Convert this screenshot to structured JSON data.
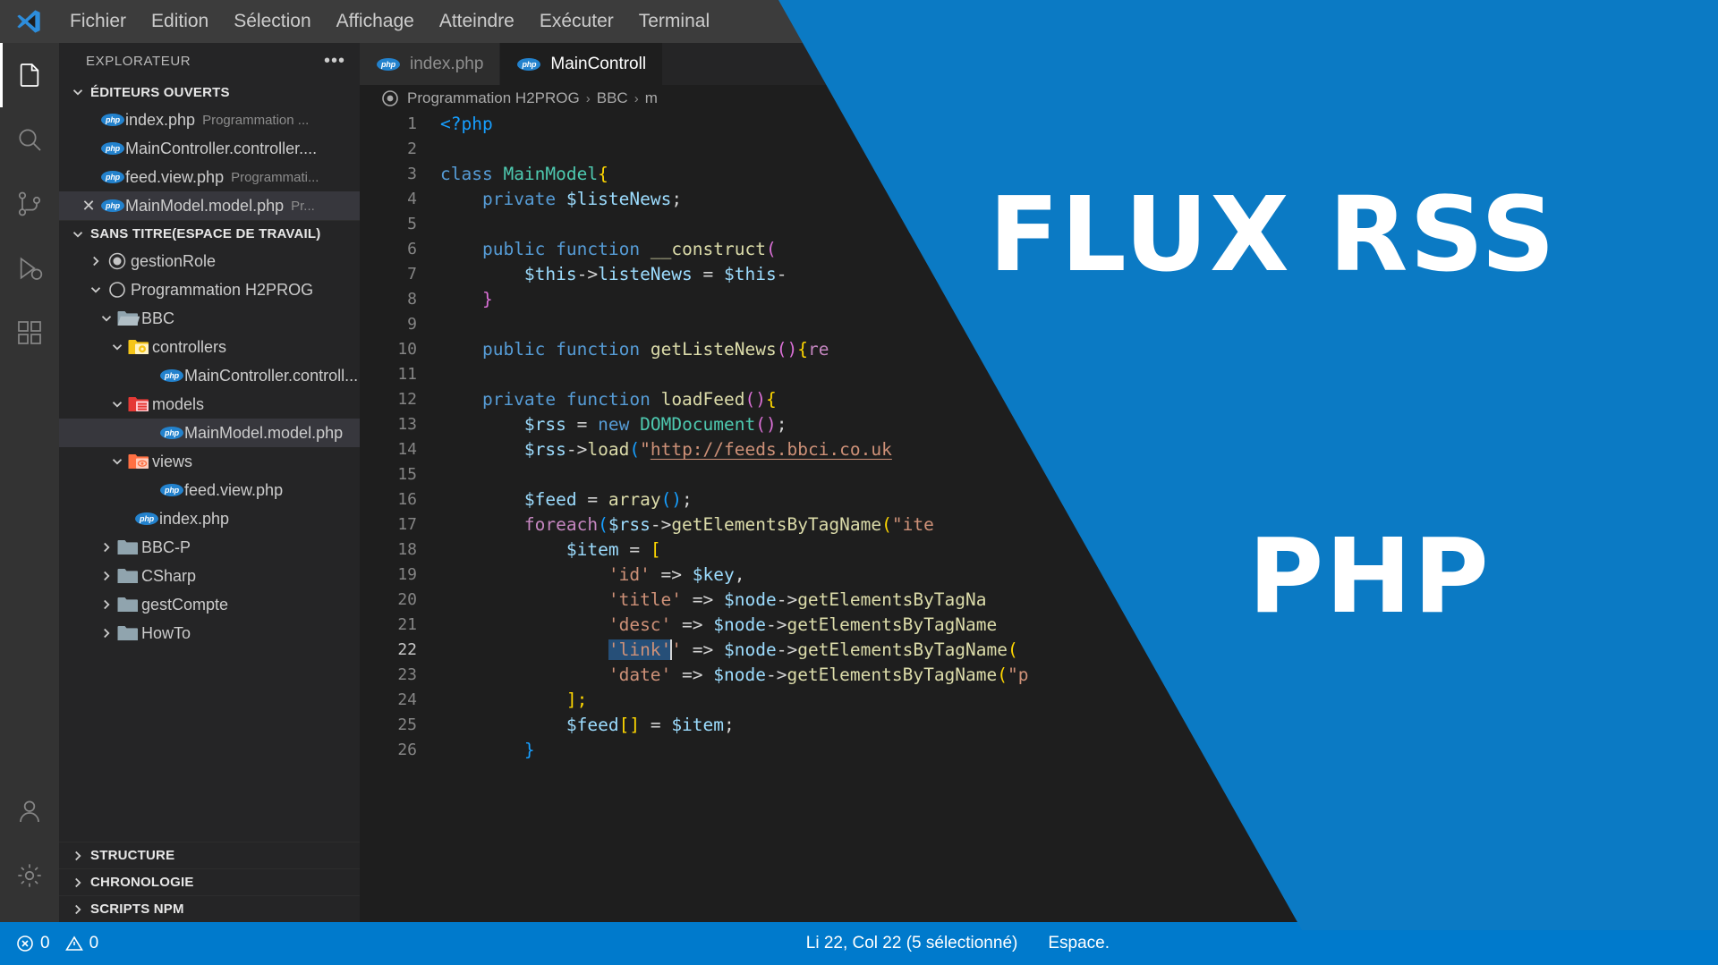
{
  "menubar": {
    "logo": "vscode-logo",
    "items": [
      "Fichier",
      "Edition",
      "Sélection",
      "Affichage",
      "Atteindre",
      "Exécuter",
      "Terminal"
    ]
  },
  "activitybar": {
    "items": [
      {
        "name": "explorer",
        "icon": "files-icon",
        "active": true
      },
      {
        "name": "search",
        "icon": "search-icon",
        "active": false
      },
      {
        "name": "source-control",
        "icon": "source-control-icon",
        "active": false
      },
      {
        "name": "run-debug",
        "icon": "run-debug-icon",
        "active": false
      },
      {
        "name": "extensions",
        "icon": "extensions-icon",
        "active": false
      }
    ],
    "bottom": [
      {
        "name": "accounts",
        "icon": "account-icon"
      },
      {
        "name": "settings",
        "icon": "gear-icon"
      }
    ]
  },
  "sidebar": {
    "title": "EXPLORATEUR",
    "more_label": "•••",
    "open_editors": {
      "label": "ÉDITEURS OUVERTS",
      "expanded": true,
      "items": [
        {
          "name": "index.php",
          "desc": "Programmation ...",
          "icon": "php-icon",
          "selected": false,
          "closable": false
        },
        {
          "name": "MainController.controller....",
          "desc": "",
          "icon": "php-icon",
          "selected": false,
          "closable": false
        },
        {
          "name": "feed.view.php",
          "desc": "Programmati...",
          "icon": "php-icon",
          "selected": false,
          "closable": false
        },
        {
          "name": "MainModel.model.php",
          "desc": "Pr...",
          "icon": "php-icon",
          "selected": true,
          "closable": true
        }
      ]
    },
    "workspace": {
      "label": "SANS TITRE(ESPACE DE TRAVAIL)",
      "expanded": true,
      "tree": [
        {
          "label": "gestionRole",
          "icon": "circle-filled-icon",
          "depth": 1,
          "arrow": "right"
        },
        {
          "label": "Programmation H2PROG",
          "icon": "circle-outline-icon",
          "depth": 1,
          "arrow": "down"
        },
        {
          "label": "BBC",
          "icon": "folder-grey-icon",
          "depth": 2,
          "arrow": "down"
        },
        {
          "label": "controllers",
          "icon": "folder-yellow-gear-icon",
          "depth": 3,
          "arrow": "down"
        },
        {
          "label": "MainController.controll...",
          "icon": "php-icon",
          "depth": 4,
          "arrow": "none"
        },
        {
          "label": "models",
          "icon": "folder-red-db-icon",
          "depth": 3,
          "arrow": "down"
        },
        {
          "label": "MainModel.model.php",
          "icon": "php-icon",
          "depth": 4,
          "arrow": "none",
          "selected": true
        },
        {
          "label": "views",
          "icon": "folder-orange-eye-icon",
          "depth": 3,
          "arrow": "down"
        },
        {
          "label": "feed.view.php",
          "icon": "php-icon",
          "depth": 4,
          "arrow": "none"
        },
        {
          "label": "index.php",
          "icon": "php-icon",
          "depth": 3,
          "arrow": "none"
        },
        {
          "label": "BBC-P",
          "icon": "folder-grey-icon",
          "depth": 2,
          "arrow": "right"
        },
        {
          "label": "CSharp",
          "icon": "folder-grey-icon",
          "depth": 2,
          "arrow": "right"
        },
        {
          "label": "gestCompte",
          "icon": "folder-grey-icon",
          "depth": 2,
          "arrow": "right"
        },
        {
          "label": "HowTo",
          "icon": "folder-grey-icon",
          "depth": 2,
          "arrow": "right"
        }
      ]
    },
    "panels": [
      {
        "label": "STRUCTURE",
        "expanded": false
      },
      {
        "label": "CHRONOLOGIE",
        "expanded": false
      },
      {
        "label": "SCRIPTS NPM",
        "expanded": false
      }
    ]
  },
  "editor": {
    "tabs": [
      {
        "label": "index.php",
        "icon": "php-icon",
        "active": false
      },
      {
        "label": "MainControll",
        "icon": "php-icon",
        "active": true
      }
    ],
    "breadcrumb": {
      "icon": "circle-outline-icon",
      "parts": [
        "Programmation H2PROG",
        "BBC",
        "m"
      ],
      "separator": "›"
    },
    "lines": [
      {
        "n": "1",
        "text": "<?php"
      },
      {
        "n": "2",
        "text": ""
      },
      {
        "n": "3",
        "text": "class MainModel{"
      },
      {
        "n": "4",
        "text": "    private $listeNews;"
      },
      {
        "n": "5",
        "text": ""
      },
      {
        "n": "6",
        "text": "    public function __construct("
      },
      {
        "n": "7",
        "text": "        $this->listeNews = $this-"
      },
      {
        "n": "8",
        "text": "    }"
      },
      {
        "n": "9",
        "text": ""
      },
      {
        "n": "10",
        "text": "    public function getListeNews(){re"
      },
      {
        "n": "11",
        "text": ""
      },
      {
        "n": "12",
        "text": "    private function loadFeed(){"
      },
      {
        "n": "13",
        "text": "        $rss = new DOMDocument();"
      },
      {
        "n": "14",
        "text": "        $rss->load(\"http://feeds.bbci.co.uk"
      },
      {
        "n": "15",
        "text": ""
      },
      {
        "n": "16",
        "text": "        $feed = array();"
      },
      {
        "n": "17",
        "text": "        foreach($rss->getElementsByTagName(\"ite"
      },
      {
        "n": "18",
        "text": "            $item = ["
      },
      {
        "n": "19",
        "text": "                'id' => $key,"
      },
      {
        "n": "20",
        "text": "                'title' => $node->getElementsByTagNa"
      },
      {
        "n": "21",
        "text": "                'desc' => $node->getElementsByTagName"
      },
      {
        "n": "22",
        "text": "                'link' => $node->getElementsByTagName(",
        "current": true,
        "selection": "'link'"
      },
      {
        "n": "23",
        "text": "                'date' => $node->getElementsByTagName(\"p"
      },
      {
        "n": "24",
        "text": "            ];"
      },
      {
        "n": "25",
        "text": "            $feed[] = $item;"
      },
      {
        "n": "26",
        "text": "        }"
      }
    ]
  },
  "statusbar": {
    "errors_icon": "error-circle-icon",
    "errors": "0",
    "warnings_icon": "warning-triangle-icon",
    "warnings": "0",
    "position": "Li 22, Col 22 (5 sélectionné)",
    "indentation": "Espace."
  },
  "overlay": {
    "color": "#0b7ac4",
    "title": "FLUX RSS",
    "subtitle": "PHP"
  }
}
